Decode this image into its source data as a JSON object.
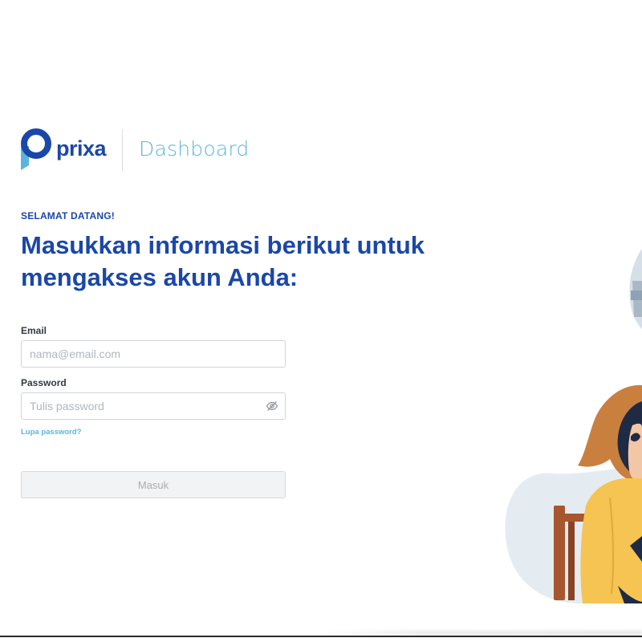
{
  "brand": {
    "logo_text": "prixa",
    "section": "Dashboard",
    "colors": {
      "primary": "#1a47a8",
      "accent": "#5bb4e0"
    }
  },
  "greeting": {
    "eyebrow": "SELAMAT DATANG!",
    "headline": "Masukkan informasi berikut untuk mengakses akun Anda:"
  },
  "form": {
    "email": {
      "label": "Email",
      "placeholder": "nama@email.com",
      "value": ""
    },
    "password": {
      "label": "Password",
      "placeholder": "Tulis password",
      "value": "",
      "toggle_icon": "eye-off-icon"
    },
    "forgot_link": "Lupa password?",
    "submit": {
      "label": "Masuk",
      "state": "disabled"
    }
  },
  "illustration": {
    "subject": "woman-in-yellow-sweater-illustration"
  }
}
